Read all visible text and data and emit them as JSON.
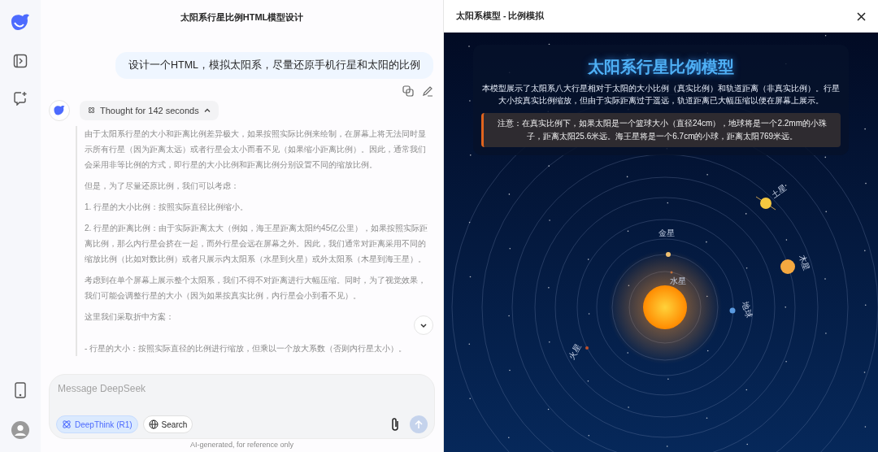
{
  "chat": {
    "title": "太阳系行星比例HTML模型设计",
    "user_message": "设计一个HTML，模拟太阳系，尽量还原手机行星和太阳的比例",
    "thought": {
      "label": "Thought for 142 seconds",
      "expanded": true
    },
    "paragraphs": [
      "由于太阳系行星的大小和距离比例差异极大，如果按照实际比例来绘制，在屏幕上将无法同时显示所有行星（因为距离太远）或者行星会太小而看不见（如果缩小距离比例）。因此，通常我们会采用非等比例的方式，即行星的大小比例和距离比例分别设置不同的缩放比例。",
      "但是，为了尽量还原比例，我们可以考虑：",
      "1. 行星的大小比例：按照实际直径比例缩小。",
      "2. 行星的距离比例：由于实际距离太大（例如，海王星距离太阳约45亿公里），如果按照实际距离比例，那么内行星会挤在一起，而外行星会远在屏幕之外。因此，我们通常对距离采用不同的缩放比例（比如对数比例）或者只展示内太阳系（水星到火星）或外太阳系（木星到海王星）。",
      "考虑到在单个屏幕上展示整个太阳系，我们不得不对距离进行大幅压缩。同时，为了视觉效果，我们可能会调整行星的大小（因为如果按真实比例，内行星会小到看不见）。",
      "这里我们采取折中方案：",
      "- 行星的大小：按照实际直径的比例进行缩放，但乘以一个放大系数（否则内行星太小）。"
    ],
    "input": {
      "placeholder": "Message DeepSeek"
    },
    "toggles": [
      {
        "label": "DeepThink (R1)",
        "selected": true
      },
      {
        "label": "Search",
        "selected": false
      }
    ],
    "footer": "AI-generated, for reference only"
  },
  "preview": {
    "title": "太阳系模型 - 比例模拟",
    "heading": "太阳系行星比例模型",
    "description": "本模型展示了太阳系八大行星相对于太阳的大小比例（真实比例）和轨道距离（非真实比例）。行星大小按真实比例缩放，但由于实际距离过于遥远，轨道距离已大幅压缩以便在屏幕上展示。",
    "note": "注意：在真实比例下，如果太阳是一个篮球大小（直径24cm），地球将是一个2.2mm的小珠子，距离太阳25.6米远。海王星将是一个6.7cm的小球，距离太阳769米远。",
    "planets": [
      {
        "name": "水星",
        "color": "#c0703a"
      },
      {
        "name": "金星",
        "color": "#f0c070"
      },
      {
        "name": "地球",
        "color": "#5a9ae0"
      },
      {
        "name": "火星",
        "color": "#c0502a"
      },
      {
        "name": "木星",
        "color": "#f5a840"
      },
      {
        "name": "土星",
        "color": "#f5c840"
      }
    ]
  }
}
